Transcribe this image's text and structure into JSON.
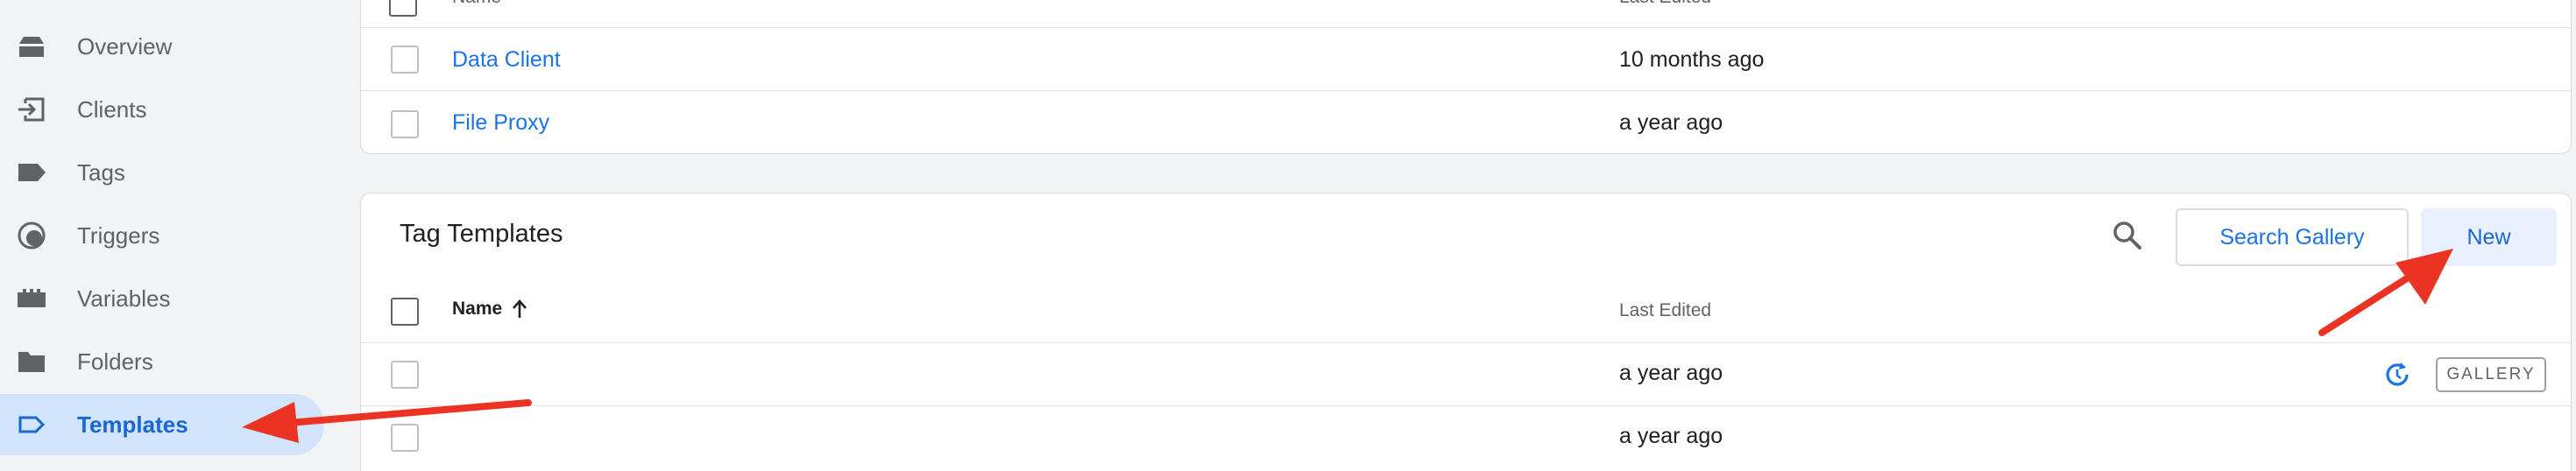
{
  "sidebar": {
    "items": [
      {
        "label": "Overview",
        "icon": "overview-icon"
      },
      {
        "label": "Clients",
        "icon": "clients-icon"
      },
      {
        "label": "Tags",
        "icon": "tag-icon"
      },
      {
        "label": "Triggers",
        "icon": "triggers-icon"
      },
      {
        "label": "Variables",
        "icon": "variables-icon"
      },
      {
        "label": "Folders",
        "icon": "folder-icon"
      },
      {
        "label": "Templates",
        "icon": "templates-icon",
        "active": true
      }
    ]
  },
  "client_templates": {
    "header": {
      "name": "Name",
      "last_edited": "Last Edited"
    },
    "rows": [
      {
        "name": "Data Client",
        "last_edited": "10 months ago"
      },
      {
        "name": "File Proxy",
        "last_edited": "a year ago"
      }
    ]
  },
  "tag_templates": {
    "title": "Tag Templates",
    "search_gallery_label": "Search Gallery",
    "new_label": "New",
    "header": {
      "name": "Name",
      "last_edited": "Last Edited"
    },
    "rows": [
      {
        "name": "",
        "last_edited": "a year ago",
        "badge": "GALLERY"
      },
      {
        "name": "",
        "last_edited": "a year ago"
      }
    ]
  },
  "colors": {
    "accent": "#1a73e8",
    "annotation": "#ea3323",
    "active_bg": "#d2e3fc"
  }
}
